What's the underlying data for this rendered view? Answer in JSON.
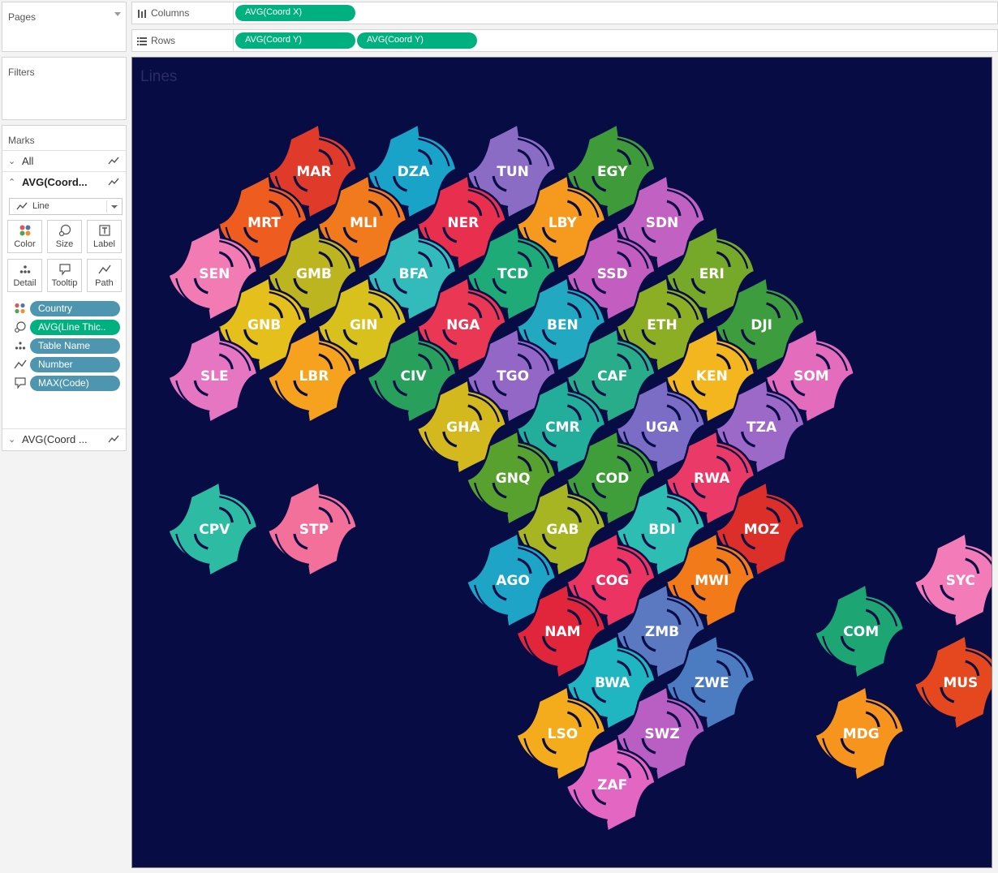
{
  "pages": {
    "title": "Pages"
  },
  "filters": {
    "title": "Filters"
  },
  "marks": {
    "title": "Marks",
    "all_label": "All",
    "layer1_label": "AVG(Coord...",
    "layer2_label": "AVG(Coord ...",
    "mark_type": "Line",
    "buttons": {
      "color": "Color",
      "size": "Size",
      "label": "Label",
      "detail": "Detail",
      "tooltip": "Tooltip",
      "path": "Path"
    },
    "pills": [
      {
        "field": "Country",
        "kind": "color"
      },
      {
        "field": "AVG(Line Thic..",
        "kind": "size"
      },
      {
        "field": "Table Name",
        "kind": "detail"
      },
      {
        "field": "Number",
        "kind": "path"
      },
      {
        "field": "MAX(Code)",
        "kind": "tooltip"
      }
    ]
  },
  "columns": {
    "label": "Columns",
    "pills": [
      "AVG(Coord X)"
    ]
  },
  "rows": {
    "label": "Rows",
    "pills": [
      "AVG(Coord Y)",
      "AVG(Coord Y)"
    ]
  },
  "viz": {
    "title": "Lines",
    "background": "#070c44"
  },
  "countries": [
    {
      "code": "MAR",
      "col": 3,
      "row": 0,
      "color": "#e03a2b"
    },
    {
      "code": "DZA",
      "col": 5,
      "row": 0,
      "color": "#1aa3c8"
    },
    {
      "code": "TUN",
      "col": 7,
      "row": 0,
      "color": "#8a6cc4"
    },
    {
      "code": "EGY",
      "col": 9,
      "row": 0,
      "color": "#3f9a3a"
    },
    {
      "code": "MRT",
      "col": 2,
      "row": 1,
      "color": "#ee5d1f"
    },
    {
      "code": "MLI",
      "col": 4,
      "row": 1,
      "color": "#f07a1c"
    },
    {
      "code": "NER",
      "col": 6,
      "row": 1,
      "color": "#e8304e"
    },
    {
      "code": "LBY",
      "col": 8,
      "row": 1,
      "color": "#f59a1e"
    },
    {
      "code": "SDN",
      "col": 10,
      "row": 1,
      "color": "#c162c2"
    },
    {
      "code": "SEN",
      "col": 1,
      "row": 2,
      "color": "#f27bb4"
    },
    {
      "code": "GMB",
      "col": 3,
      "row": 2,
      "color": "#bdb520"
    },
    {
      "code": "BFA",
      "col": 5,
      "row": 2,
      "color": "#33bbbb"
    },
    {
      "code": "TCD",
      "col": 7,
      "row": 2,
      "color": "#1fab78"
    },
    {
      "code": "SSD",
      "col": 9,
      "row": 2,
      "color": "#c35dc0"
    },
    {
      "code": "ERI",
      "col": 11,
      "row": 2,
      "color": "#76a92a"
    },
    {
      "code": "GNB",
      "col": 2,
      "row": 3,
      "color": "#e5bf1b"
    },
    {
      "code": "GIN",
      "col": 4,
      "row": 3,
      "color": "#d8c01d"
    },
    {
      "code": "NGA",
      "col": 6,
      "row": 3,
      "color": "#ea3753"
    },
    {
      "code": "BEN",
      "col": 8,
      "row": 3,
      "color": "#22a9c1"
    },
    {
      "code": "ETH",
      "col": 10,
      "row": 3,
      "color": "#8cae25"
    },
    {
      "code": "DJI",
      "col": 12,
      "row": 3,
      "color": "#3d9c3d"
    },
    {
      "code": "SLE",
      "col": 1,
      "row": 4,
      "color": "#e676c2"
    },
    {
      "code": "LBR",
      "col": 3,
      "row": 4,
      "color": "#f6a21e"
    },
    {
      "code": "CIV",
      "col": 5,
      "row": 4,
      "color": "#28a05c"
    },
    {
      "code": "TGO",
      "col": 7,
      "row": 4,
      "color": "#9267c6"
    },
    {
      "code": "CAF",
      "col": 9,
      "row": 4,
      "color": "#28ac8a"
    },
    {
      "code": "KEN",
      "col": 11,
      "row": 4,
      "color": "#f3b61f"
    },
    {
      "code": "SOM",
      "col": 13,
      "row": 4,
      "color": "#e36cbd"
    },
    {
      "code": "GHA",
      "col": 6,
      "row": 5,
      "color": "#d3b91e"
    },
    {
      "code": "CMR",
      "col": 8,
      "row": 5,
      "color": "#22ae9b"
    },
    {
      "code": "UGA",
      "col": 10,
      "row": 5,
      "color": "#7b6cc5"
    },
    {
      "code": "TZA",
      "col": 12,
      "row": 5,
      "color": "#9d69c9"
    },
    {
      "code": "GNQ",
      "col": 7,
      "row": 6,
      "color": "#58a12e"
    },
    {
      "code": "COD",
      "col": 9,
      "row": 6,
      "color": "#3f9e3a"
    },
    {
      "code": "RWA",
      "col": 11,
      "row": 6,
      "color": "#ea3b68"
    },
    {
      "code": "CPV",
      "col": 1,
      "row": 7,
      "color": "#2ebba4"
    },
    {
      "code": "STP",
      "col": 3,
      "row": 7,
      "color": "#f2709a"
    },
    {
      "code": "GAB",
      "col": 8,
      "row": 7,
      "color": "#a8b522"
    },
    {
      "code": "BDI",
      "col": 10,
      "row": 7,
      "color": "#2ebdb2"
    },
    {
      "code": "MOZ",
      "col": 12,
      "row": 7,
      "color": "#dc2f2a"
    },
    {
      "code": "AGO",
      "col": 7,
      "row": 8,
      "color": "#1ea4c6"
    },
    {
      "code": "COG",
      "col": 9,
      "row": 8,
      "color": "#eb3461"
    },
    {
      "code": "MWI",
      "col": 11,
      "row": 8,
      "color": "#f37a19"
    },
    {
      "code": "SYC",
      "col": 16,
      "row": 8,
      "color": "#f27bb8"
    },
    {
      "code": "NAM",
      "col": 8,
      "row": 9,
      "color": "#e1253b"
    },
    {
      "code": "ZMB",
      "col": 10,
      "row": 9,
      "color": "#5a79c1"
    },
    {
      "code": "COM",
      "col": 14,
      "row": 9,
      "color": "#1da574"
    },
    {
      "code": "BWA",
      "col": 9,
      "row": 10,
      "color": "#1fb5c1"
    },
    {
      "code": "ZWE",
      "col": 11,
      "row": 10,
      "color": "#4b7bc0"
    },
    {
      "code": "MUS",
      "col": 16,
      "row": 10,
      "color": "#e5471f"
    },
    {
      "code": "LSO",
      "col": 8,
      "row": 11,
      "color": "#f4ac1d"
    },
    {
      "code": "SWZ",
      "col": 10,
      "row": 11,
      "color": "#b95fc4"
    },
    {
      "code": "MDG",
      "col": 14,
      "row": 11,
      "color": "#f7941d"
    },
    {
      "code": "ZAF",
      "col": 9,
      "row": 12,
      "color": "#e466c3"
    }
  ]
}
